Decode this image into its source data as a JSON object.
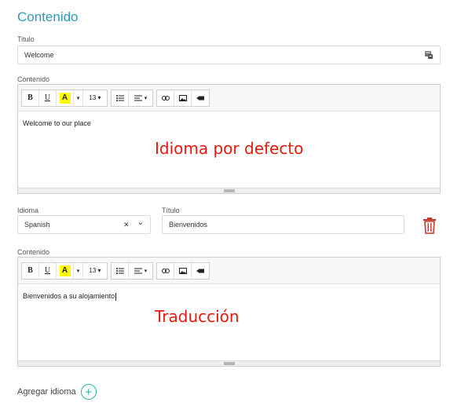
{
  "section_title": "Contenido",
  "default": {
    "title_label": "Titulo",
    "title_value": "Welcome",
    "content_label": "Contenido",
    "content_text": "Welcome to our place",
    "overlay": "Idioma por defecto"
  },
  "translation": {
    "language_label": "Idioma",
    "language_value": "Spanish",
    "clear_symbol": "✕",
    "dropdown_symbol": "⌄",
    "title_label": "Título",
    "title_value": "Bienvenidos",
    "content_label": "Contenido",
    "content_text": "Bienvenidos a su alojamiento",
    "overlay": "Traducción"
  },
  "toolbar": {
    "bold": "B",
    "underline": "U",
    "highlight": "A",
    "caret": "▾",
    "font_size": "13 ▾"
  },
  "add_language": {
    "label": "Agregar idioma",
    "plus": "+"
  },
  "colors": {
    "accent": "#2a9db5",
    "overlay_text": "#e8190c",
    "delete_icon": "#c0392b",
    "add_button": "#2ab3a3"
  },
  "icons": [
    "translate-icon",
    "bold-icon",
    "underline-icon",
    "highlight-icon",
    "unordered-list-icon",
    "align-icon",
    "link-icon",
    "image-icon",
    "video-icon",
    "trash-icon",
    "plus-circle-icon"
  ]
}
